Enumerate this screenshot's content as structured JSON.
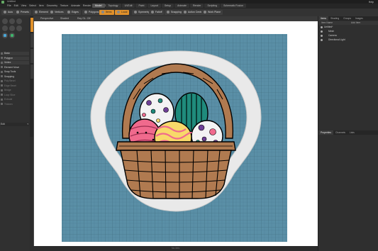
{
  "app": {
    "title": "Untitled",
    "menu": [
      "File",
      "Edit",
      "View",
      "Select",
      "Item",
      "Geometry",
      "Texture",
      "Animate",
      "Render",
      "Layout",
      "System",
      "Help"
    ],
    "layout_tabs": [
      "Model",
      "Topology",
      "UVEdit",
      "Paint",
      "Layout",
      "Setup",
      "Animate",
      "Render",
      "Scripting",
      "Schematic Fusion"
    ],
    "active_layout_tab": "Model",
    "help_label": "Help"
  },
  "toolbar": {
    "items": [
      {
        "label": "Auto",
        "style": "normal"
      },
      {
        "label": "Presets",
        "style": "normal"
      },
      {
        "label": "Element",
        "style": "normal"
      },
      {
        "label": "Vertices",
        "style": "normal"
      },
      {
        "label": "Edges",
        "style": "normal"
      },
      {
        "label": "Polygons",
        "style": "normal"
      },
      {
        "label": "Items",
        "style": "orange"
      },
      {
        "label": "Local",
        "style": "orange"
      },
      {
        "label": "Symmetry",
        "style": "normal"
      },
      {
        "label": "Falloff",
        "style": "normal"
      },
      {
        "label": "Snapping",
        "style": "normal"
      },
      {
        "label": "Action Center",
        "style": "normal"
      },
      {
        "label": "Work Plane",
        "style": "normal"
      }
    ]
  },
  "left_panel": {
    "rows": [
      {
        "label": "Basic",
        "style": "sel"
      },
      {
        "label": "Polygon",
        "style": "sel"
      },
      {
        "label": "Vertex",
        "style": "sel"
      },
      {
        "label": "Element Move",
        "style": "normal"
      },
      {
        "label": "Snap Tools",
        "style": "normal"
      },
      {
        "label": "Snapping",
        "style": "normal"
      },
      {
        "label": "Poly Bevel",
        "style": "dim"
      },
      {
        "label": "Edge Bevel",
        "style": "dim"
      },
      {
        "label": "Bridge",
        "style": "dim"
      },
      {
        "label": "Loop Slice",
        "style": "dim"
      },
      {
        "label": "Extrude",
        "style": "dim"
      },
      {
        "label": "Thicken",
        "style": "dim"
      }
    ],
    "bottom_select": "Edit"
  },
  "viewport": {
    "header": [
      "Perspective",
      "Shaded",
      "Ray GL: Off"
    ],
    "footer": "No Info",
    "colors": {
      "grid_bg": "#5a8fa6",
      "grid_line": "#49798e",
      "cutter": "#e7e7e7",
      "basket": "#b07a50",
      "egg_pink": "#f06a8d",
      "egg_yellow": "#f8d96a",
      "egg_teal": "#1f8b7c",
      "egg_white": "#f3f3f3",
      "egg_purple": "#6e3f96"
    }
  },
  "right_panel": {
    "top_tabs": [
      "Items",
      "Shading",
      "Groups",
      "Images"
    ],
    "columns": [
      "Item Name",
      "Add Item"
    ],
    "tree": [
      {
        "label": "Untitled*",
        "indent": 0
      },
      {
        "label": "Mesh",
        "indent": 1
      },
      {
        "label": "Camera",
        "indent": 1
      },
      {
        "label": "Directional Light",
        "indent": 1
      }
    ],
    "bottom_tabs": [
      "Properties",
      "Channels",
      "Lists"
    ]
  }
}
